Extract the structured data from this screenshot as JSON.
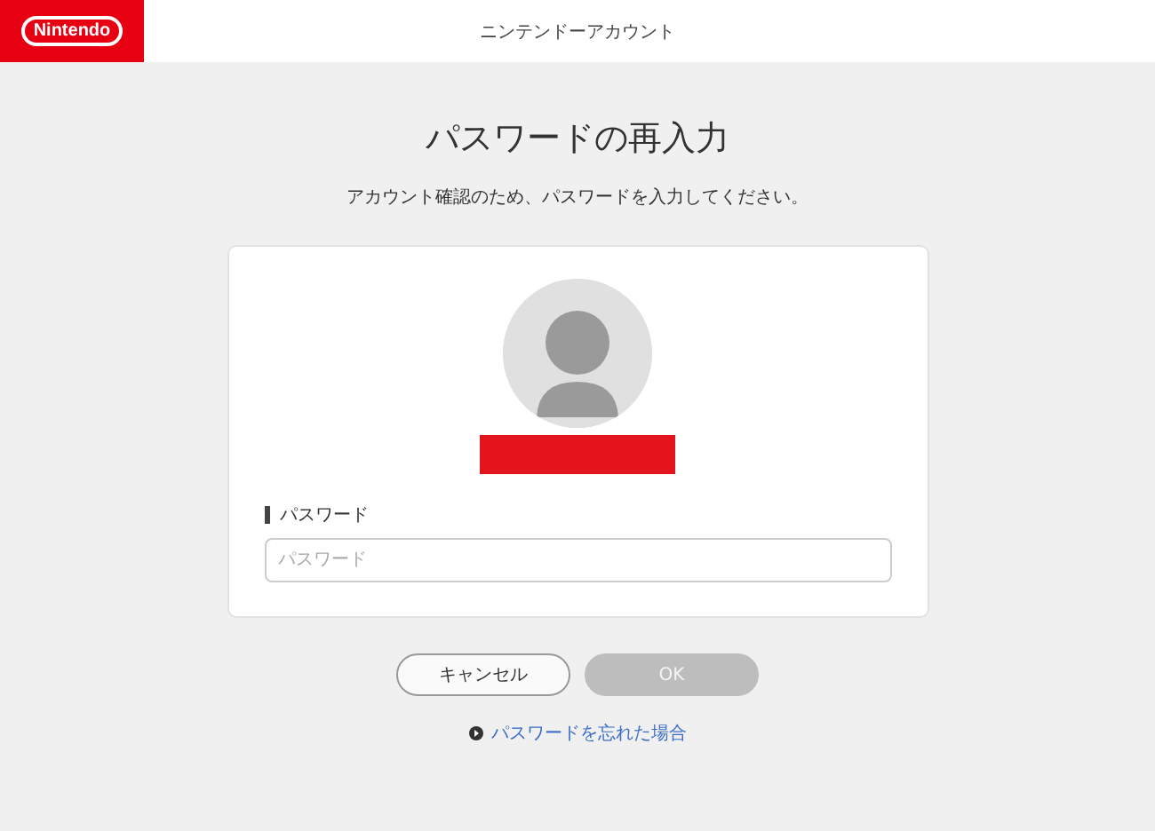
{
  "header": {
    "logo": "Nintendo",
    "title": "ニンテンドーアカウント"
  },
  "heading": "パスワードの再入力",
  "description": "アカウント確認のため、パスワードを入力してください。",
  "password": {
    "label": "パスワード",
    "placeholder": "パスワード"
  },
  "buttons": [
    {
      "label": "キャンセル",
      "kind": "secondary",
      "disabled": false
    },
    {
      "label": "OK",
      "kind": "primary",
      "disabled": true
    }
  ],
  "forgot_link": "パスワードを忘れた場合"
}
